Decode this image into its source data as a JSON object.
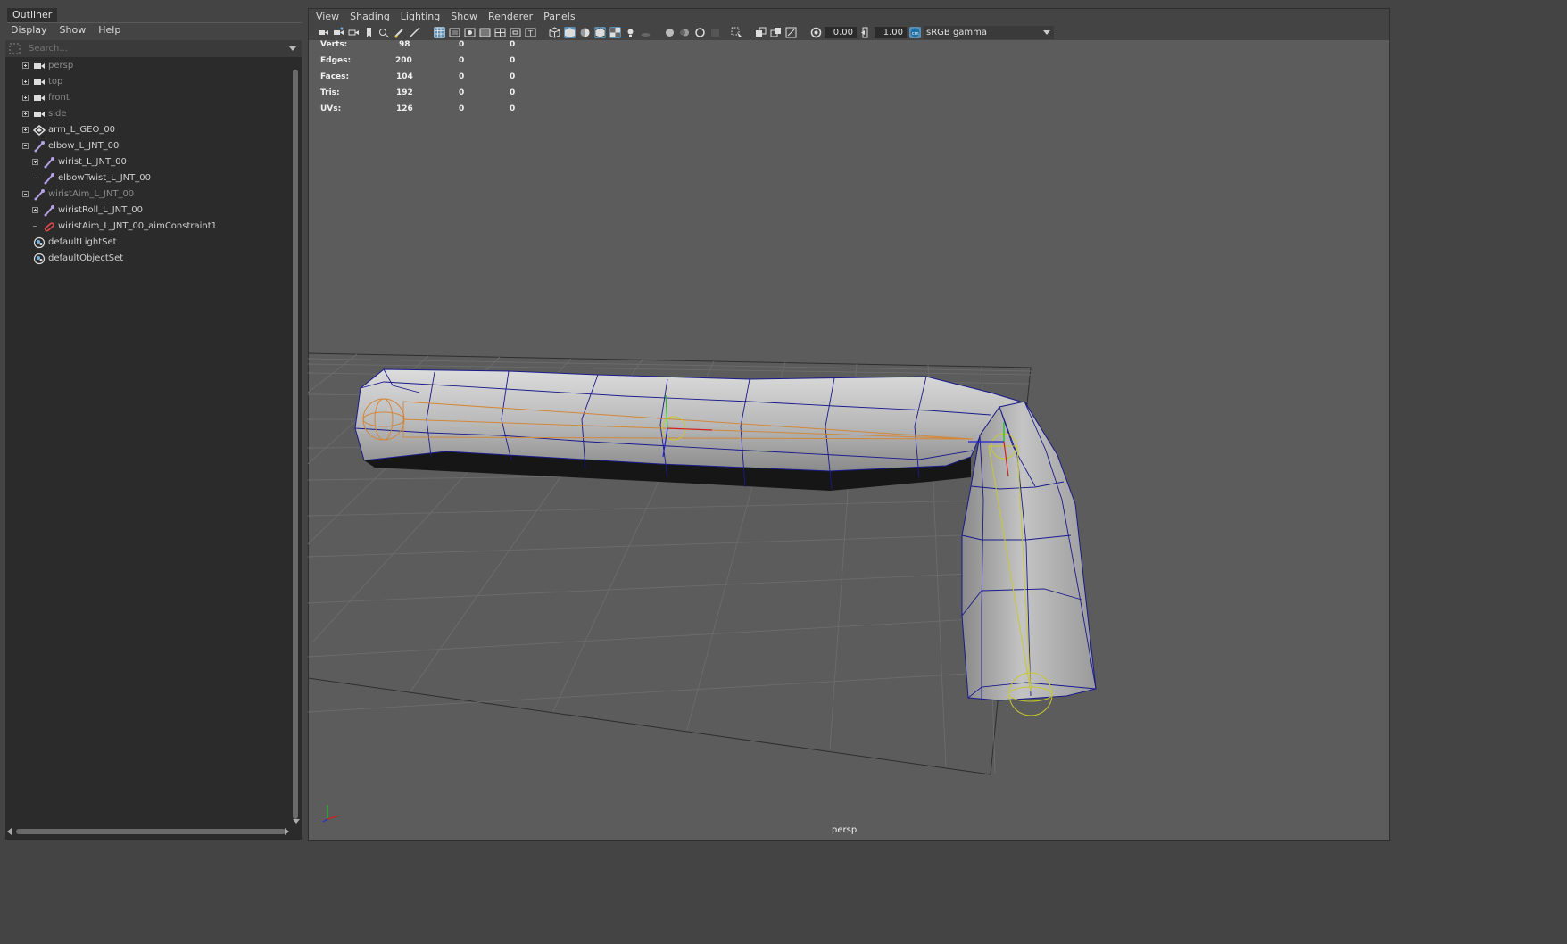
{
  "outliner": {
    "tab": "Outliner",
    "menu": [
      "Display",
      "Show",
      "Help"
    ],
    "search_placeholder": "Search...",
    "items": [
      {
        "label": "persp",
        "icon": "camera-icon"
      },
      {
        "label": "top",
        "icon": "camera-icon"
      },
      {
        "label": "front",
        "icon": "camera-icon"
      },
      {
        "label": "side",
        "icon": "camera-icon"
      },
      {
        "label": "arm_L_GEO_00",
        "icon": "mesh-transform-icon"
      },
      {
        "label": "elbow_L_JNT_00",
        "icon": "joint-icon"
      },
      {
        "label": "wirist_L_JNT_00",
        "icon": "joint-icon"
      },
      {
        "label": "elbowTwist_L_JNT_00",
        "icon": "joint-icon"
      },
      {
        "label": "wiristAim_L_JNT_00",
        "icon": "joint-icon"
      },
      {
        "label": "wiristRoll_L_JNT_00",
        "icon": "joint-icon"
      },
      {
        "label": "wiristAim_L_JNT_00_aimConstraint1",
        "icon": "aim-constraint-icon"
      },
      {
        "label": "defaultLightSet",
        "icon": "set-icon"
      },
      {
        "label": "defaultObjectSet",
        "icon": "set-icon"
      }
    ]
  },
  "viewport": {
    "menu": [
      "View",
      "Shading",
      "Lighting",
      "Show",
      "Renderer",
      "Panels"
    ],
    "exposure": "0.00",
    "gamma": "1.00",
    "color_space": "sRGB gamma",
    "camera": "persp",
    "hud": [
      {
        "label": "Verts:",
        "v1": "98",
        "v2": "0",
        "v3": "0"
      },
      {
        "label": "Edges:",
        "v1": "200",
        "v2": "0",
        "v3": "0"
      },
      {
        "label": "Faces:",
        "v1": "104",
        "v2": "0",
        "v3": "0"
      },
      {
        "label": "Tris:",
        "v1": "192",
        "v2": "0",
        "v3": "0"
      },
      {
        "label": "UVs:",
        "v1": "126",
        "v2": "0",
        "v3": "0"
      }
    ]
  },
  "colors": {
    "selected_wire": "#1a1a8c",
    "joint_orange": "#d2873a",
    "joint_yellow": "#c8c832",
    "accent_blue": "#5c8fb4"
  }
}
